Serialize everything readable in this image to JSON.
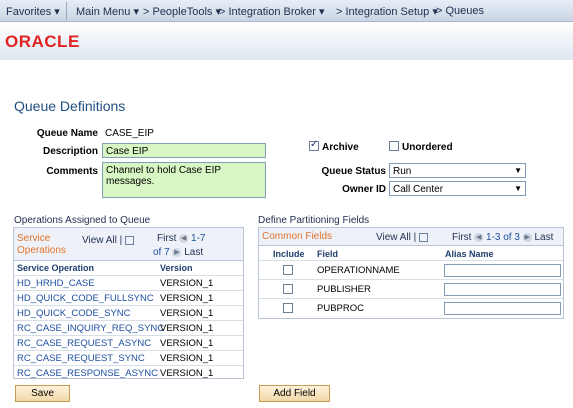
{
  "nav": {
    "favorites": "Favorites ▾",
    "main_menu": "Main Menu ▾",
    "crumb_peopletools": "> PeopleTools ▾",
    "crumb_integration_broker": "> Integration Broker ▾",
    "crumb_integration_setup": "> Integration Setup ▾",
    "crumb_queues": "> Queues"
  },
  "brand": {
    "logo_text": "ORACLE",
    "logo_color": "#e02424"
  },
  "page": {
    "title": "Queue Definitions"
  },
  "form": {
    "queue_name_label": "Queue Name",
    "queue_name_value": "CASE_EIP",
    "description_label": "Description",
    "description_value": "Case EIP",
    "comments_label": "Comments",
    "comments_value": "Channel to hold Case EIP messages.",
    "archive_label": "Archive",
    "archive_checked": true,
    "unordered_label": "Unordered",
    "unordered_checked": false,
    "queue_status_label": "Queue Status",
    "queue_status_value": "Run",
    "owner_id_label": "Owner ID",
    "owner_id_value": "Call Center"
  },
  "operations": {
    "section_title": "Operations Assigned to Queue",
    "grid_title_line1": "Service",
    "grid_title_line2": "Operations",
    "view_all": "View All",
    "first": "First",
    "range": "1-7",
    "of": "of 7",
    "last": "Last",
    "col_service_operation": "Service Operation",
    "col_version": "Version",
    "rows": [
      {
        "op": "HD_HRHD_CASE",
        "version": "VERSION_1"
      },
      {
        "op": "HD_QUICK_CODE_FULLSYNC",
        "version": "VERSION_1"
      },
      {
        "op": "HD_QUICK_CODE_SYNC",
        "version": "VERSION_1"
      },
      {
        "op": "RC_CASE_INQUIRY_REQ_SYNC",
        "version": "VERSION_1"
      },
      {
        "op": "RC_CASE_REQUEST_ASYNC",
        "version": "VERSION_1"
      },
      {
        "op": "RC_CASE_REQUEST_SYNC",
        "version": "VERSION_1"
      },
      {
        "op": "RC_CASE_RESPONSE_ASYNC",
        "version": "VERSION_1"
      }
    ]
  },
  "partitioning": {
    "section_title": "Define Partitioning Fields",
    "grid_title": "Common Fields",
    "view_all": "View All",
    "first": "First",
    "range": "1-3 of 3",
    "last": "Last",
    "col_include": "Include",
    "col_field": "Field",
    "col_alias": "Alias Name",
    "rows": [
      {
        "field": "OPERATIONNAME",
        "alias": ""
      },
      {
        "field": "PUBLISHER",
        "alias": ""
      },
      {
        "field": "PUBPROC",
        "alias": ""
      }
    ]
  },
  "buttons": {
    "save": "Save",
    "add_field": "Add Field"
  }
}
